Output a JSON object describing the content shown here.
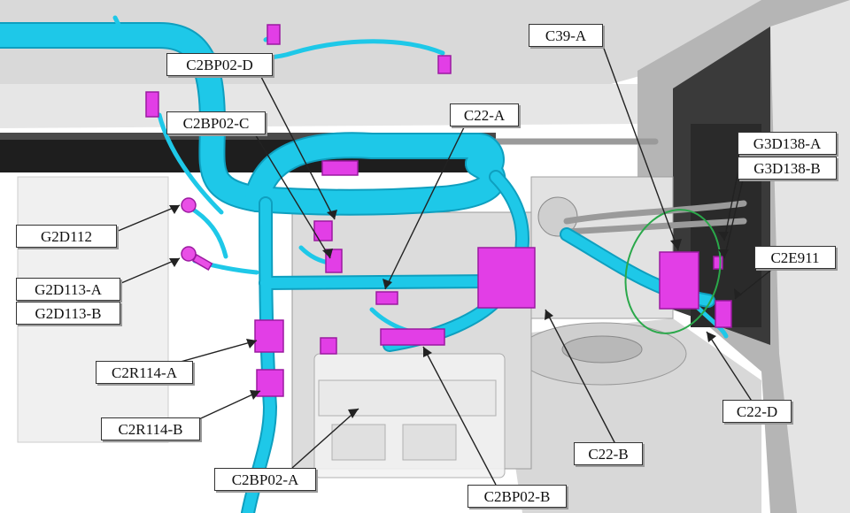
{
  "diagram": {
    "callouts": [
      {
        "id": "c39a",
        "label": "C39-A"
      },
      {
        "id": "c2bp02d",
        "label": "C2BP02-D"
      },
      {
        "id": "c2bp02c",
        "label": "C2BP02-C"
      },
      {
        "id": "c22a",
        "label": "C22-A"
      },
      {
        "id": "g3d138a",
        "label": "G3D138-A"
      },
      {
        "id": "g3d138b",
        "label": "G3D138-B"
      },
      {
        "id": "g2d112",
        "label": "G2D112"
      },
      {
        "id": "c2e911",
        "label": "C2E911"
      },
      {
        "id": "g2d113a",
        "label": "G2D113-A"
      },
      {
        "id": "g2d113b",
        "label": "G2D113-B"
      },
      {
        "id": "c2r114a",
        "label": "C2R114-A"
      },
      {
        "id": "c22d",
        "label": "C22-D"
      },
      {
        "id": "c2r114b",
        "label": "C2R114-B"
      },
      {
        "id": "c22b",
        "label": "C22-B"
      },
      {
        "id": "c2bp02a",
        "label": "C2BP02-A"
      },
      {
        "id": "c2bp02b",
        "label": "C2BP02-B"
      }
    ],
    "colors": {
      "harness": "#1ec8e8",
      "harness_dark": "#0e9fbf",
      "connector": "#e23ee6",
      "connector_dark": "#9b1aa0",
      "highlight_ring": "#2aa84a",
      "leader_line": "#222222",
      "background_structure": "#c8c8c8"
    }
  }
}
